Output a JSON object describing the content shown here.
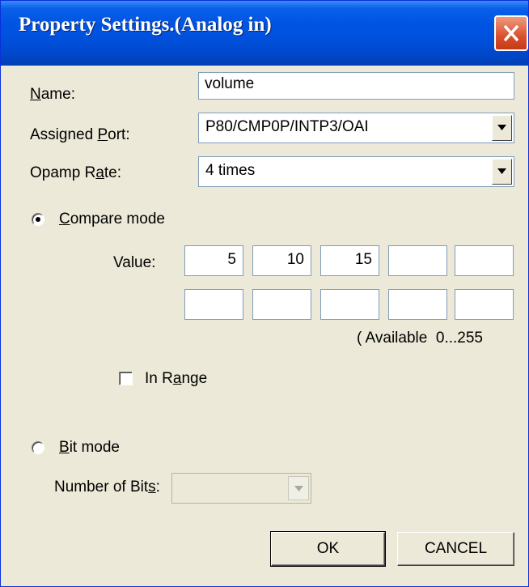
{
  "window": {
    "title": "Property Settings.(Analog in)"
  },
  "name_field": {
    "label_prefix": "",
    "label_hotkey": "N",
    "label_rest": "ame:",
    "value": "volume"
  },
  "assigned_port": {
    "label_prefix": "Assigned ",
    "label_hotkey": "P",
    "label_rest": "ort:",
    "value": "P80/CMP0P/INTP3/OAI"
  },
  "opamp_rate": {
    "label_prefix": "Opamp R",
    "label_hotkey": "a",
    "label_rest": "te:",
    "value": "4 times"
  },
  "compare_mode": {
    "hotkey": "C",
    "rest": "ompare mode",
    "selected": true
  },
  "value_grid": {
    "label": "Value:",
    "row1": [
      "5",
      "10",
      "15",
      "",
      ""
    ],
    "row2": [
      "",
      "",
      "",
      "",
      ""
    ],
    "available_note": "( Available  0...255"
  },
  "in_range": {
    "label_prefix": "In R",
    "label_hotkey": "a",
    "label_rest": "nge",
    "checked": false
  },
  "bit_mode": {
    "hotkey": "B",
    "rest": "it mode",
    "selected": false
  },
  "number_of_bits": {
    "label_prefix": "Number of Bit",
    "label_hotkey": "s",
    "label_rest": ":",
    "value": ""
  },
  "buttons": {
    "ok": "OK",
    "cancel": "CANCEL"
  }
}
